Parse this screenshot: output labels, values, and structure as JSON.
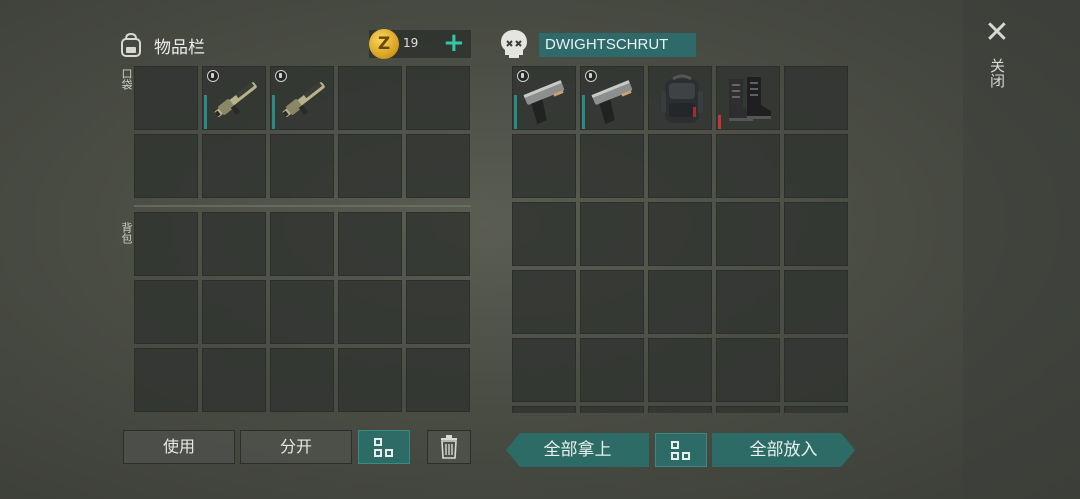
{
  "inventory": {
    "title": "物品栏",
    "pocket_label": "口袋",
    "backpack_label": "背包",
    "coins": "19",
    "coin_symbol": "Z",
    "plus": "+"
  },
  "loot": {
    "owner_name": "DWIGHTSCHRUT"
  },
  "actions": {
    "use": "使用",
    "split": "分开",
    "take_all": "全部拿上",
    "put_all": "全部放入"
  },
  "close": {
    "icon": "✕",
    "label": "关闭"
  },
  "pocket_items": [
    "",
    "rifle",
    "rifle",
    "",
    "",
    "",
    "",
    "",
    "",
    ""
  ],
  "loot_items": [
    "pistol",
    "pistol",
    "backpack",
    "boots",
    ""
  ],
  "colors": {
    "accent_teal": "#2d6c66",
    "name_bg": "#2e6a6a",
    "coin_gold": "#e0b030",
    "plus_green": "#34c6a6",
    "durability_red": "#c83434"
  }
}
